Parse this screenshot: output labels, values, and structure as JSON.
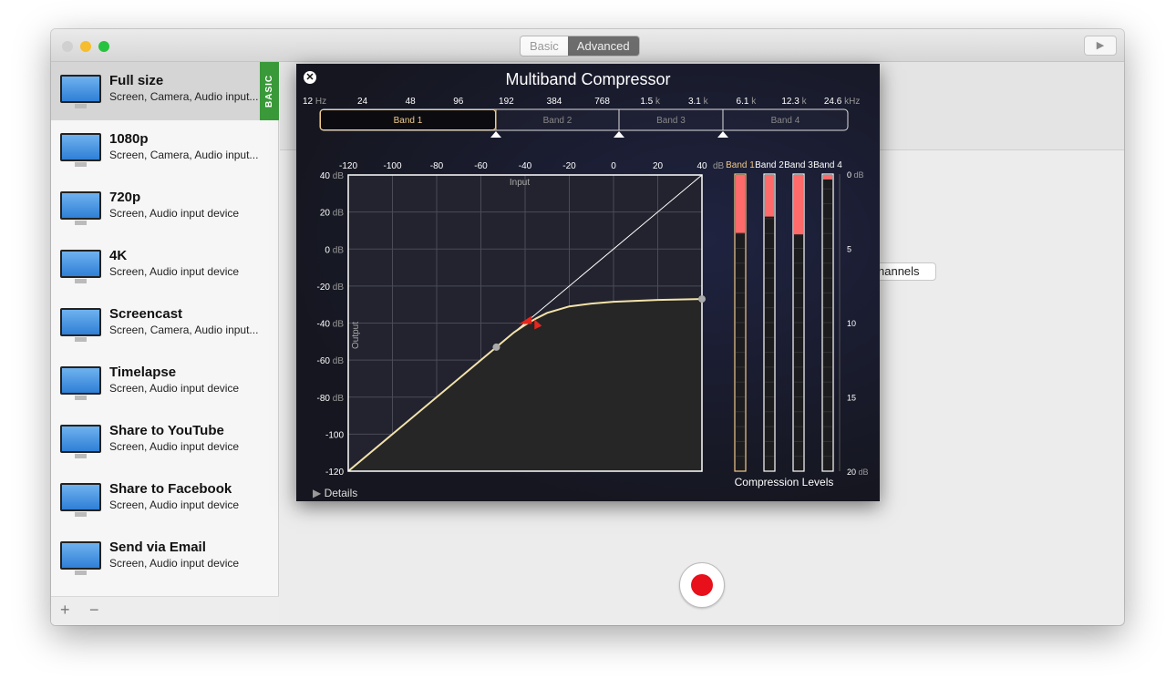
{
  "window": {
    "tabs": [
      {
        "label": "Basic",
        "active": false
      },
      {
        "label": "Advanced",
        "active": true
      }
    ],
    "toolbar_icon": "play-preview-icon"
  },
  "sidebar": {
    "items": [
      {
        "title": "Full size",
        "subtitle": "Screen, Camera, Audio input...",
        "selected": true,
        "badge": "BASIC"
      },
      {
        "title": "1080p",
        "subtitle": "Screen, Camera, Audio input..."
      },
      {
        "title": "720p",
        "subtitle": "Screen, Audio input device"
      },
      {
        "title": "4K",
        "subtitle": "Screen, Audio input device"
      },
      {
        "title": "Screencast",
        "subtitle": "Screen, Camera, Audio input..."
      },
      {
        "title": "Timelapse",
        "subtitle": "Screen, Audio input device"
      },
      {
        "title": "Share to YouTube",
        "subtitle": "Screen, Audio input device"
      },
      {
        "title": "Share to Facebook",
        "subtitle": "Screen, Audio input device"
      },
      {
        "title": "Send via Email",
        "subtitle": "Screen, Audio input device"
      }
    ],
    "add_label": "+",
    "remove_label": "−",
    "badge_color": "#3a9a3a"
  },
  "main": {
    "channels_label": "hannels",
    "record_color": "#e8101a"
  },
  "compressor": {
    "title": "Multiband Compressor",
    "details_label": "Details",
    "freq_labels": [
      [
        "12",
        " Hz"
      ],
      [
        "24",
        ""
      ],
      [
        "48",
        ""
      ],
      [
        "96",
        ""
      ],
      [
        "192",
        ""
      ],
      [
        "384",
        ""
      ],
      [
        "768",
        ""
      ],
      [
        "1.5",
        " k"
      ],
      [
        "3.1",
        " k"
      ],
      [
        "6.1",
        " k"
      ],
      [
        "12.3",
        " k"
      ],
      [
        "24.6",
        " kHz"
      ]
    ],
    "bands": [
      "Band 1",
      "Band 2",
      "Band 3",
      "Band 4"
    ],
    "selected_band": "Band 1",
    "accent": "#f0c98a",
    "compression_title": "Compression Levels",
    "compression_scale": [
      "0 dB",
      "5",
      "10",
      "15",
      "20 dB"
    ]
  },
  "chart_data": [
    {
      "type": "line",
      "title": "",
      "xlabel": "Input",
      "ylabel": "Output",
      "xlim": [
        -120,
        40
      ],
      "ylim": [
        -120,
        40
      ],
      "xticks": [
        "-120",
        "-100",
        "-80",
        "-60",
        "-40",
        "-20",
        "0",
        "20",
        "40"
      ],
      "x_unit": "dB",
      "yticks": [
        "40 dB",
        "20 dB",
        "0 dB",
        "-20 dB",
        "-40 dB",
        "-60 dB",
        "-80 dB",
        "-100",
        "-120"
      ],
      "grid": true,
      "series": [
        {
          "role": "reference",
          "x": [
            -120,
            40
          ],
          "y": [
            -120,
            40
          ],
          "color": "#ffffff"
        },
        {
          "role": "transfer",
          "x": [
            -120,
            -53,
            -45,
            -40,
            -35,
            -30,
            -20,
            -10,
            0,
            20,
            40
          ],
          "y": [
            -120,
            -53,
            -45,
            -41,
            -37.5,
            -34.5,
            -31,
            -29.5,
            -28.5,
            -27.5,
            -27
          ],
          "color": "#f4e3a8"
        }
      ],
      "handles": [
        {
          "x": -53,
          "y": -53
        },
        {
          "x": 40,
          "y": -27
        }
      ],
      "threshold_marker": {
        "x": -37,
        "y": -39,
        "color": "#e8261c"
      }
    },
    {
      "type": "bar",
      "title": "Compression Levels",
      "categories": [
        "Band 1",
        "Band 2",
        "Band 3",
        "Band 4"
      ],
      "values": [
        3.9,
        2.8,
        4.0,
        0.3
      ],
      "ylim": [
        0,
        20
      ],
      "unit": "dB",
      "color": "#ff6b6b"
    }
  ]
}
